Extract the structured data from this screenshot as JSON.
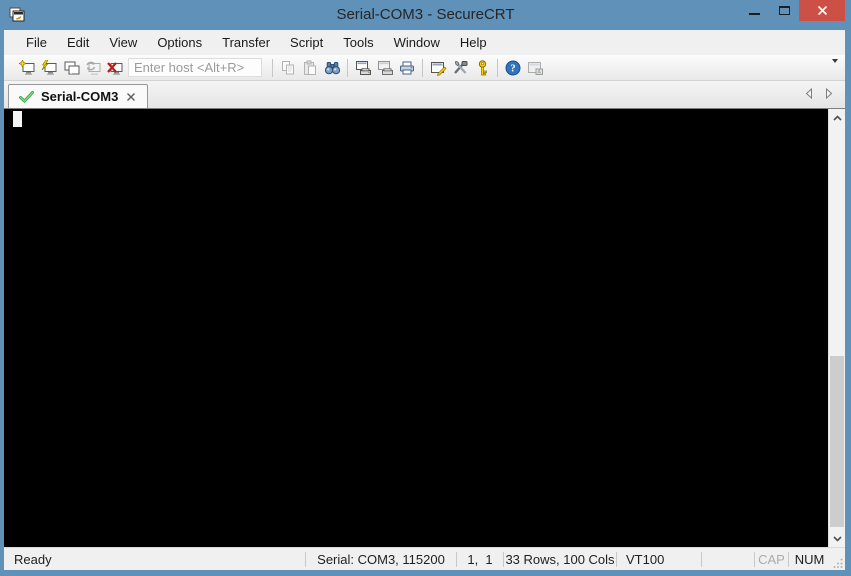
{
  "window": {
    "title": "Serial-COM3 - SecureCRT",
    "controls": [
      "minimize",
      "maximize",
      "close"
    ]
  },
  "menu": {
    "items": [
      "File",
      "Edit",
      "View",
      "Options",
      "Transfer",
      "Script",
      "Tools",
      "Window",
      "Help"
    ]
  },
  "toolbar": {
    "host_field": {
      "value": "",
      "placeholder": "Enter host <Alt+R>"
    },
    "buttons": [
      "connect",
      "quick-connect",
      "connect-in-tab",
      "reconnect",
      "disconnect",
      "copy",
      "paste",
      "find",
      "print-screen",
      "auto-print",
      "print-setup",
      "session-options",
      "global-options",
      "keymap",
      "help",
      "securefx"
    ],
    "disabled_buttons": [
      "reconnect",
      "copy",
      "paste",
      "securefx"
    ]
  },
  "tabbar": {
    "tabs": [
      {
        "label": "Serial-COM3",
        "status": "connected",
        "active": true
      }
    ]
  },
  "terminal": {
    "content": "",
    "cursor": "block at row 1, col 1"
  },
  "statusbar": {
    "status": "Ready",
    "connection": "Serial: COM3, 115200",
    "cursor_pos": "1,  1",
    "screen_size": "33 Rows, 100 Cols",
    "emulation": "VT100",
    "caps_indicator": "CAP",
    "num_indicator": "NUM"
  },
  "colors": {
    "titlebar": "#5f91b9",
    "close_button": "#cd5046",
    "terminal_bg": "#000000",
    "tab_check_green": "#3fae49",
    "chrome_bg": "#f0f0f0"
  }
}
